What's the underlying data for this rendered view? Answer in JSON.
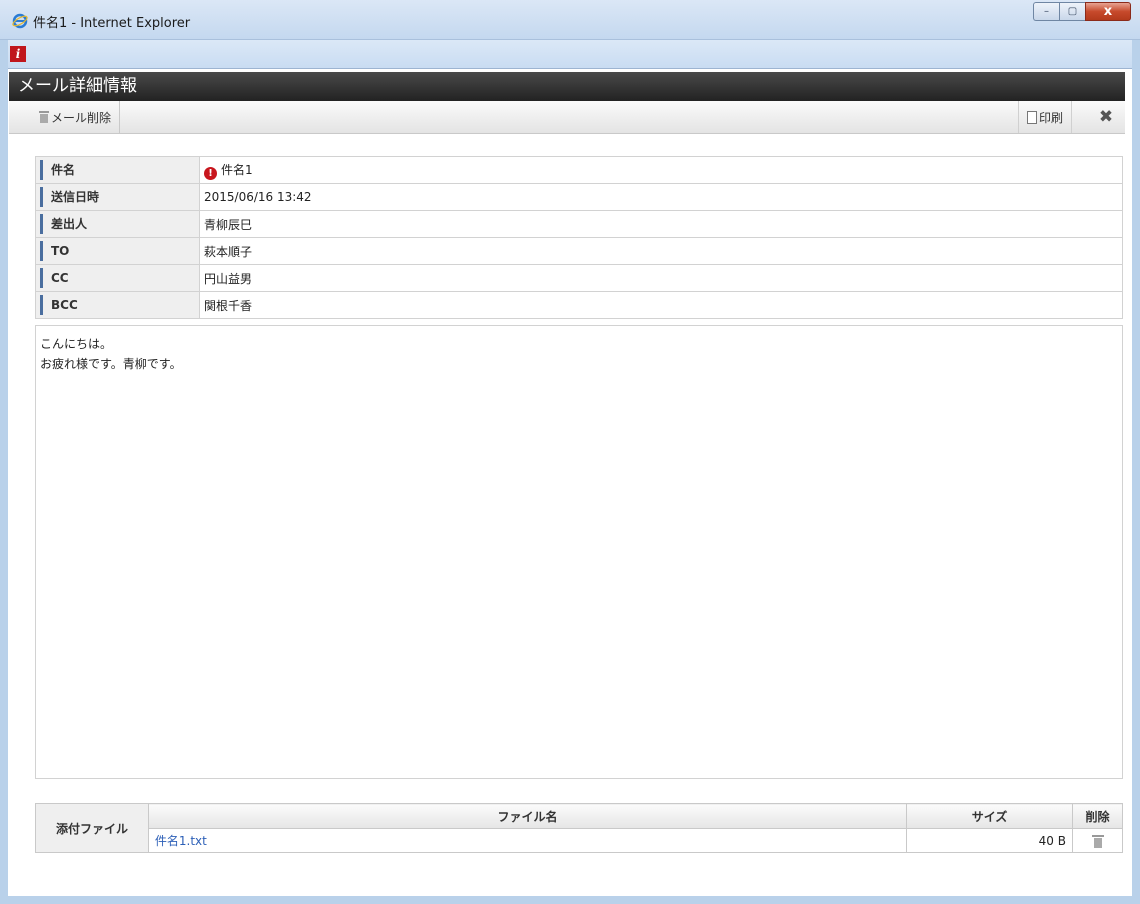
{
  "window": {
    "title": "件名1 - Internet Explorer",
    "minimize": "–",
    "maximize": "▢",
    "close": "x"
  },
  "app": {
    "logo_text": "i",
    "header": "メール詳細情報"
  },
  "toolbar": {
    "delete_label": "メール削除",
    "print_label": "印刷",
    "close_glyph": "✖"
  },
  "details": {
    "rows": [
      {
        "label": "件名",
        "value": "件名1",
        "alert": true
      },
      {
        "label": "送信日時",
        "value": "2015/06/16 13:42"
      },
      {
        "label": "差出人",
        "value": "青柳辰巳"
      },
      {
        "label": "TO",
        "value": "萩本順子"
      },
      {
        "label": "CC",
        "value": "円山益男"
      },
      {
        "label": "BCC",
        "value": "関根千香"
      }
    ]
  },
  "body": {
    "lines": [
      "こんにちは。",
      "お疲れ様です。青柳です。"
    ]
  },
  "attachments": {
    "section_label": "添付ファイル",
    "col_name": "ファイル名",
    "col_size": "サイズ",
    "col_delete": "削除",
    "files": [
      {
        "name": "件名1.txt",
        "size": "40 B"
      }
    ]
  },
  "colors": {
    "header_bg": "#2b2b2b",
    "label_accent": "#4a6e9f",
    "link": "#2c5fb7",
    "alert": "#c8161d"
  }
}
